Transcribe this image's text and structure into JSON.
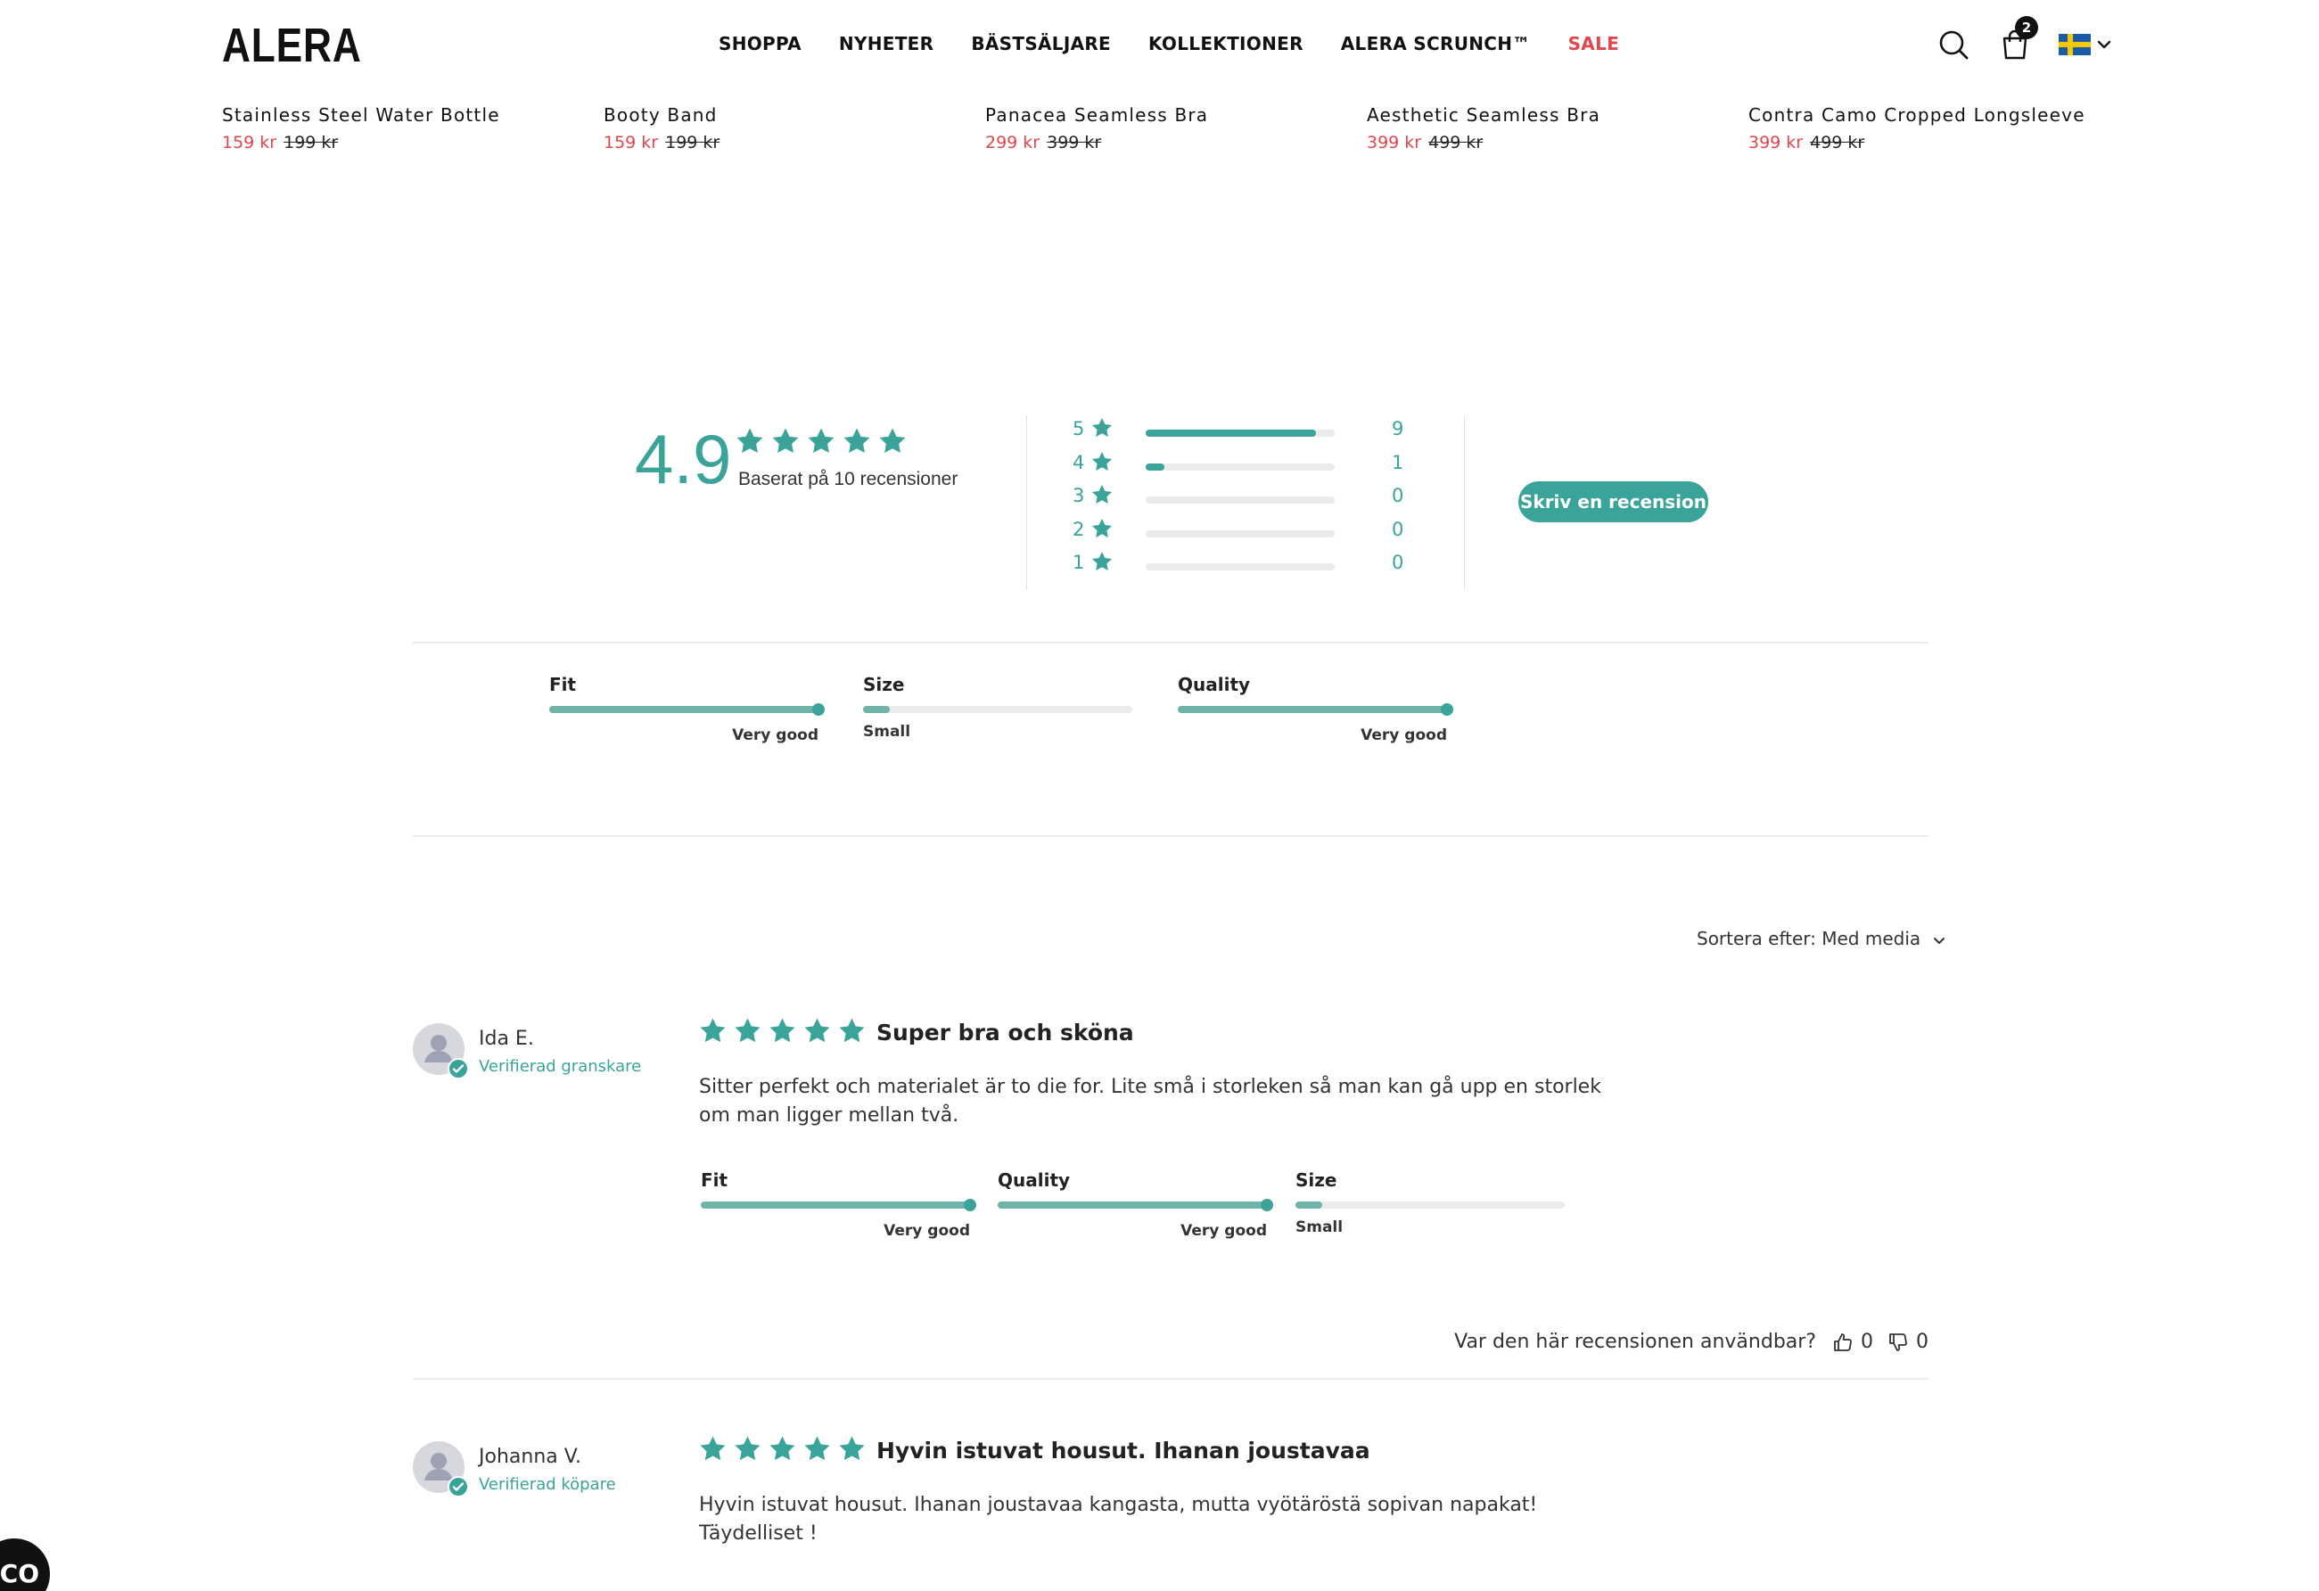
{
  "brand": {
    "logo": "ALERA"
  },
  "nav": {
    "items": [
      "SHOPPA",
      "NYHETER",
      "BÄSTSÄLJARE",
      "KOLLEKTIONER",
      "ALERA SCRUNCH™",
      "SALE"
    ]
  },
  "cart": {
    "count": "2"
  },
  "icons": {
    "search": "search-icon",
    "cart": "shopping-bag-icon",
    "flag": "sweden-flag-icon",
    "chevron": "chevron-down-icon",
    "star": "star-icon",
    "thumbs_up": "thumbs-up-icon",
    "thumbs_down": "thumbs-down-icon"
  },
  "colors": {
    "accent": "#3aa39a",
    "sale": "#e0474c",
    "text": "#222222"
  },
  "products": [
    {
      "name": "Stainless Steel Water Bottle",
      "sale_price": "159 kr",
      "original_price": "199 kr"
    },
    {
      "name": "Booty Band",
      "sale_price": "159 kr",
      "original_price": "199 kr"
    },
    {
      "name": "Panacea Seamless Bra",
      "sale_price": "299 kr",
      "original_price": "399 kr"
    },
    {
      "name": "Aesthetic Seamless Bra",
      "sale_price": "399 kr",
      "original_price": "499 kr"
    },
    {
      "name": "Contra Camo Cropped Longsleeve",
      "sale_price": "399 kr",
      "original_price": "499 kr"
    }
  ],
  "summary": {
    "average": "4.9",
    "stars": 5,
    "based_on": "Baserat på 10 recensioner",
    "distribution": [
      {
        "stars": "5",
        "count": "9",
        "fraction": 0.9
      },
      {
        "stars": "4",
        "count": "1",
        "fraction": 0.1
      },
      {
        "stars": "3",
        "count": "0",
        "fraction": 0
      },
      {
        "stars": "2",
        "count": "0",
        "fraction": 0
      },
      {
        "stars": "1",
        "count": "0",
        "fraction": 0
      }
    ],
    "write_review": "Skriv en recension"
  },
  "attributes": [
    {
      "label": "Fit",
      "value": "Very good",
      "level": 1.0
    },
    {
      "label": "Size",
      "value": "Small",
      "level": 0.1
    },
    {
      "label": "Quality",
      "value": "Very good",
      "level": 1.0
    }
  ],
  "sort": {
    "label": "Sortera efter:",
    "value": "Med media"
  },
  "reviews": [
    {
      "name": "Ida E.",
      "badge": "Verifierad granskare",
      "rating": 5,
      "title": "Super bra och sköna",
      "body": "Sitter perfekt och materialet är to die for. Lite små i storleken så man kan gå upp en storlek om man ligger mellan två.",
      "attributes": [
        {
          "label": "Fit",
          "value": "Very good",
          "level": 1.0
        },
        {
          "label": "Quality",
          "value": "Very good",
          "level": 1.0
        },
        {
          "label": "Size",
          "value": "Small",
          "level": 0.1
        }
      ],
      "helpful_label": "Var den här recensionen användbar?",
      "up": "0",
      "down": "0"
    },
    {
      "name": "Johanna V.",
      "badge": "Verifierad köpare",
      "rating": 5,
      "title": "Hyvin istuvat housut. Ihanan joustavaa",
      "body": "Hyvin istuvat housut. Ihanan joustavaa kangasta, mutta vyötäröstä sopivan napakat! Täydelliset !"
    }
  ],
  "chat": {
    "label": "CO"
  }
}
